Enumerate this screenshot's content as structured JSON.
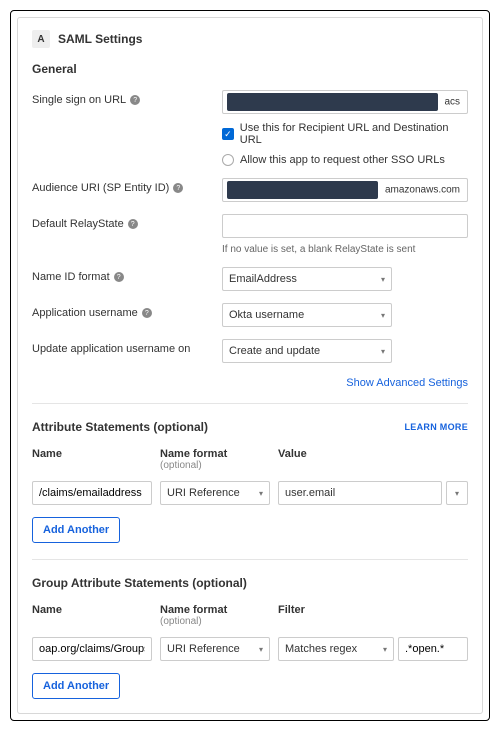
{
  "header": {
    "letter": "A",
    "title": "SAML Settings"
  },
  "section": {
    "general": "General"
  },
  "fields": {
    "sso_url": {
      "label": "Single sign on URL",
      "suffix": "acs",
      "chk1": "Use this for Recipient URL and Destination URL",
      "chk2": "Allow this app to request other SSO URLs"
    },
    "audience": {
      "label": "Audience URI (SP Entity ID)",
      "suffix": "amazonaws.com"
    },
    "relay": {
      "label": "Default RelayState",
      "hint": "If no value is set, a blank RelayState is sent"
    },
    "nameid": {
      "label": "Name ID format",
      "value": "EmailAddress"
    },
    "appuser": {
      "label": "Application username",
      "value": "Okta username"
    },
    "updateon": {
      "label": "Update application username on",
      "value": "Create and update"
    }
  },
  "links": {
    "advanced": "Show Advanced Settings",
    "learn": "LEARN MORE"
  },
  "attr": {
    "heading": "Attribute Statements (optional)",
    "cols": {
      "name": "Name",
      "format": "Name format",
      "format_sub": "(optional)",
      "value": "Value"
    },
    "row": {
      "name": "/claims/emailaddress",
      "format": "URI Reference",
      "value": "user.email"
    },
    "add": "Add Another"
  },
  "group": {
    "heading": "Group Attribute Statements (optional)",
    "cols": {
      "name": "Name",
      "format": "Name format",
      "format_sub": "(optional)",
      "filter": "Filter"
    },
    "row": {
      "name": "oap.org/claims/Groups",
      "format": "URI Reference",
      "filter": "Matches regex",
      "pattern": ".*open.*"
    },
    "add": "Add Another"
  }
}
